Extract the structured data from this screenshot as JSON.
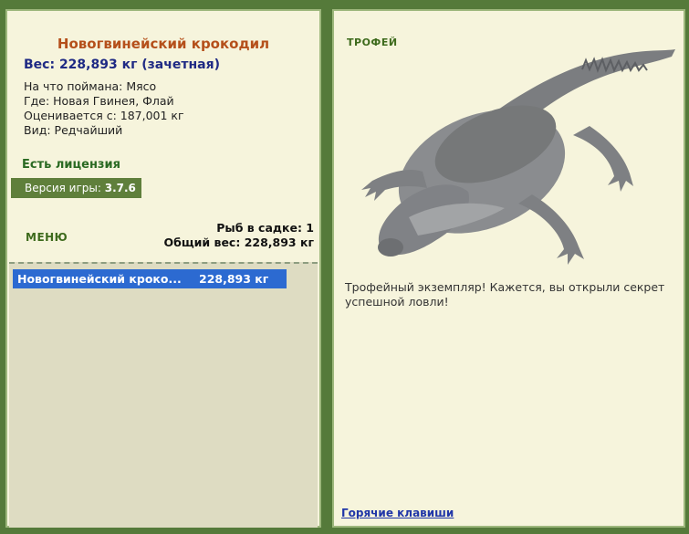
{
  "fish": {
    "name": "Новогвинейский крокодил",
    "weight_line": "Вес: 228,893 кг (зачетная)",
    "bait": "На что поймана: Мясо",
    "location": "Где: Новая Гвинея, Флай",
    "rated_from": "Оценивается с: 187,001 кг",
    "rarity": "Вид: Редчайший"
  },
  "license": "Есть лицензия",
  "version": {
    "label": "Версия игры:",
    "value": "3.7.6"
  },
  "menu_label": "МЕНЮ",
  "keepnet": {
    "count": "Рыб в садке: 1",
    "total": "Общий вес: 228,893 кг",
    "items": [
      {
        "name": "Новогвинейский кроко...",
        "weight": "228,893 кг"
      }
    ]
  },
  "trophy": {
    "label": "ТРОФЕЙ",
    "text": "Трофейный экземпляр! Кажется, вы открыли секрет успешной ловли!"
  },
  "hotkeys_link": "Горячие клавиши",
  "colors": {
    "frame": "#557a3a",
    "panel": "#f6f4dc",
    "title": "#b5501b",
    "weight": "#1f2a84",
    "selected_row": "#2c6ad1"
  }
}
